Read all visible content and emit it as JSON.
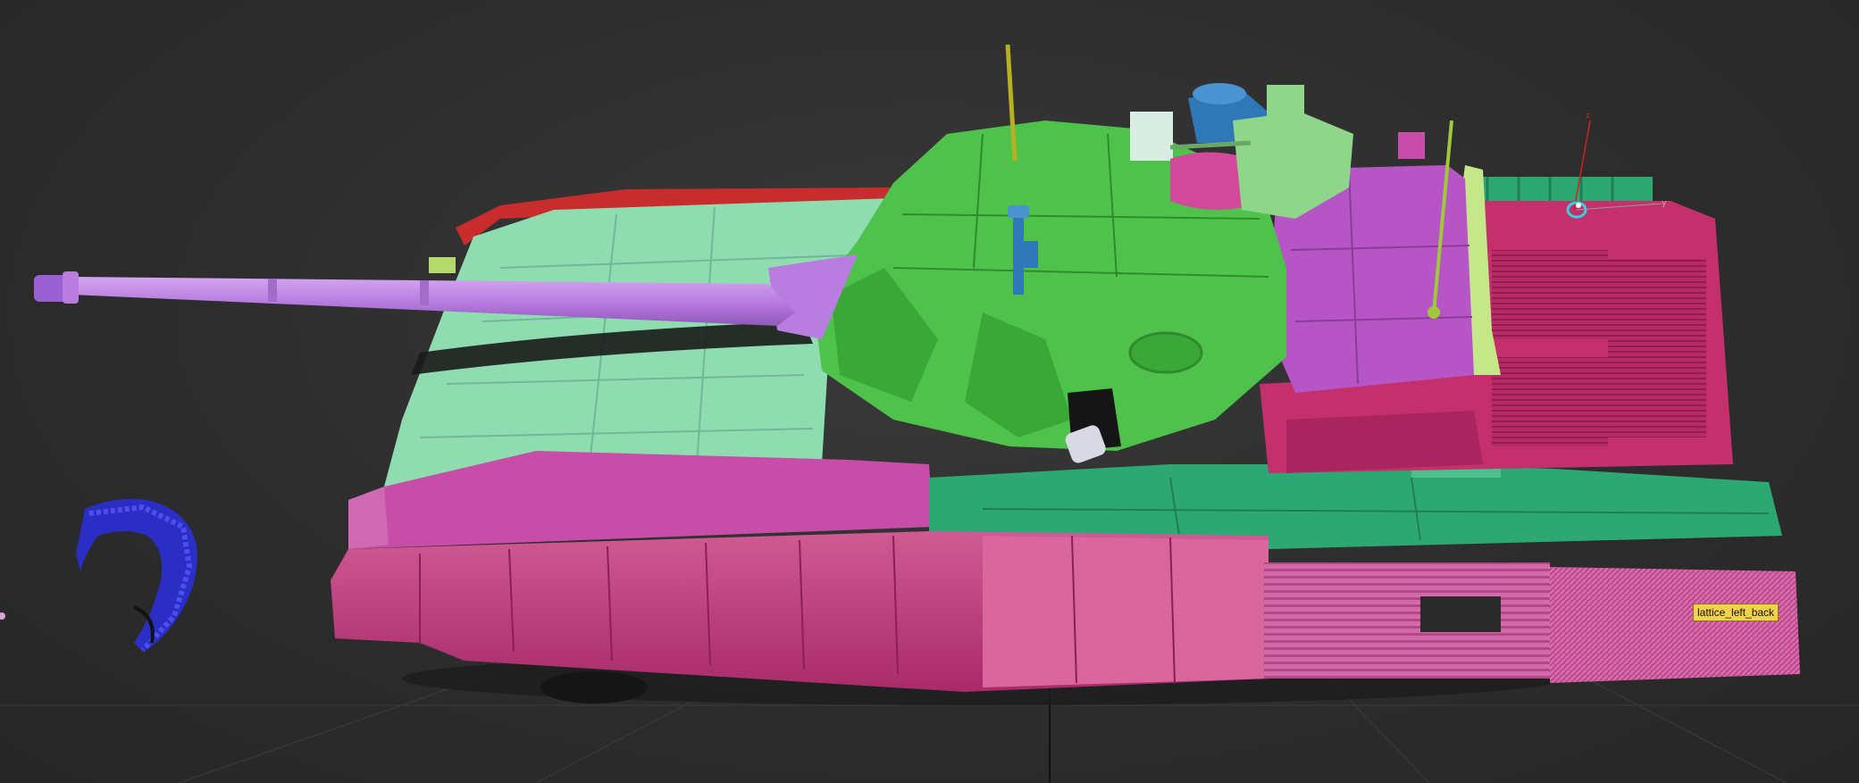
{
  "viewport": {
    "selected_object_tooltip": "lattice_left_back"
  },
  "colors": {
    "background": "#2d2d2d",
    "grid": "#3c3c3c",
    "hull_side_magenta": "#c0347f",
    "hull_side_light_pink": "#d9679e",
    "fender_pink": "#c64ea8",
    "hull_top_mint": "#8fdcb1",
    "turret_green": "#4ec24a",
    "gun_barrel_lilac": "#b97de0",
    "rear_hull_violet": "#b656c6",
    "rear_deck_crimson": "#c4306b",
    "side_skirt_teal": "#2ea873",
    "rear_lattice_pink": "#cf5aa0",
    "rear_rail_lime": "#c6e68a",
    "sight_blue": "#2f78b8",
    "sight_white": "#d9ede2",
    "sight_light_green": "#8fd68a",
    "antenna_olive": "#b6b022",
    "antenna_lime": "#9fc83a",
    "left_fender_red": "#c82c2c",
    "track_links_blue": "#2a2ec4"
  }
}
